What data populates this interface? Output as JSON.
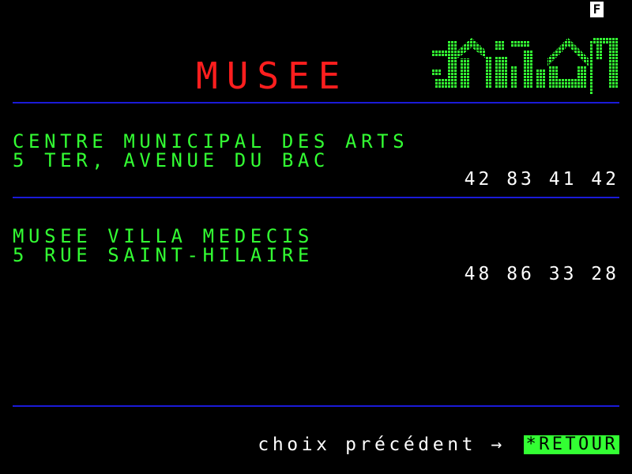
{
  "status": {
    "indicator": "F"
  },
  "header": {
    "title": "MUSEE"
  },
  "entries": [
    {
      "name": "CENTRE MUNICIPAL DES ARTS",
      "address": "5 TER, AVENUE DU BAC",
      "phone": "42 83 41 42"
    },
    {
      "name": "MUSEE VILLA MEDECIS",
      "address": "5 RUE SAINT-HILAIRE",
      "phone": "48 86 33 28"
    }
  ],
  "footer": {
    "prompt": "choix précédent →",
    "button": "*RETOUR"
  },
  "colors": {
    "background": "#000000",
    "title": "#ff1e1e",
    "text_green": "#33ff33",
    "text_white": "#ffffff",
    "rule_blue": "#1a1ad8"
  }
}
